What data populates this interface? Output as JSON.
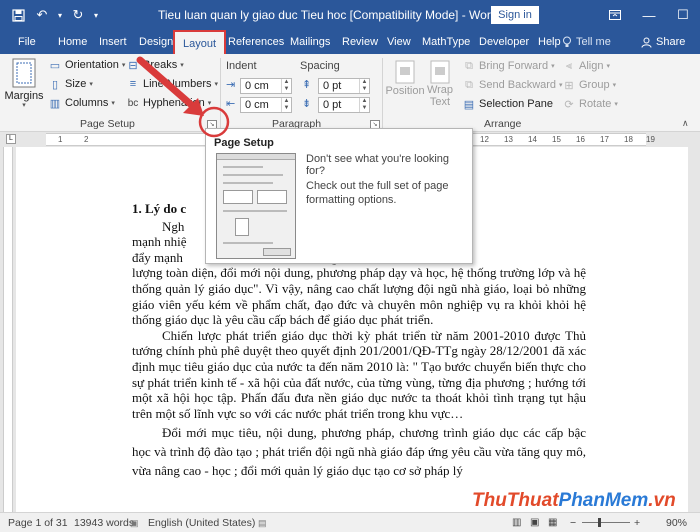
{
  "window": {
    "title": "Tieu luan quan ly giao duc Tieu hoc [Compatibility Mode] - Word",
    "sign_in": "Sign in"
  },
  "tabs": [
    "File",
    "Home",
    "Insert",
    "Design",
    "Layout",
    "References",
    "Mailings",
    "Review",
    "View",
    "MathType",
    "Developer",
    "Help"
  ],
  "active_tab": "Layout",
  "tell_me": "Tell me",
  "share": "Share",
  "ribbon": {
    "page_setup": {
      "margins": "Margins",
      "orientation": "Orientation",
      "size": "Size",
      "columns": "Columns",
      "breaks": "Breaks",
      "line_numbers": "Line Numbers",
      "hyphenation": "Hyphenation",
      "label": "Page Setup"
    },
    "paragraph": {
      "indent_label": "Indent",
      "spacing_label": "Spacing",
      "indent_left": "0 cm",
      "indent_right": "0 cm",
      "spacing_before": "0 pt",
      "spacing_after": "0 pt",
      "label": "Paragraph"
    },
    "arrange": {
      "position": "Position",
      "wrap_text_1": "Wrap",
      "wrap_text_2": "Text",
      "bring_forward": "Bring Forward",
      "send_backward": "Send Backward",
      "selection_pane": "Selection Pane",
      "align": "Align",
      "group": "Group",
      "rotate": "Rotate",
      "label": "Arrange"
    }
  },
  "tooltip": {
    "title": "Page Setup",
    "line1": "Don't see what you're looking for?",
    "line2": "Check out the full set of page formatting options."
  },
  "ruler_numbers": [
    "1",
    "2",
    "1",
    "2",
    "3",
    "4",
    "5",
    "6",
    "7",
    "8",
    "9",
    "10",
    "11",
    "12",
    "13",
    "14",
    "15",
    "16",
    "17",
    "18",
    "19"
  ],
  "document": {
    "heading": "1. Lý do c",
    "p1_lines": [
      "Ngh                                            X của Đảng đã nhấn",
      "mạnh nhiệ                                      rờng hotrong thời kỳ",
      "đẩy mạnh                                       cao giáo dục chất"
    ],
    "p1_rest": "lượng toàn diện, đổi mới nội dung, phương pháp dạy và học, hệ thống trường lớp và hệ thống quản lý giáo dục\". Vì vậy, nâng cao chất lượng đội ngũ nhà giáo, loại bỏ những giáo viên yếu kém về phẩm chất, đạo đức và chuyên môn nghiệp vụ ra khỏi khỏi hệ thống giáo dục là yêu cầu cấp bách để giáo dục phát triển.",
    "p2": "Chiến lược phát triển giáo dục thời kỳ phát triển từ năm 2001-2010 được Thủ tướng chính phủ phê duyệt theo quyết định 201/2001/QĐ-TTg ngày 28/12/2001 đã xác định mục tiêu giáo dục của nước ta đến năm 2010 là: \" Tạo bước chuyển biến thực cho sự phát triển kinh tế - xã hội của đất nước, của từng vùng, từng địa phương ; hướng tới một xã hội học tập. Phấn đấu đưa nền giáo dục nước ta thoát khỏi tình trạng tụt hậu trên một số lĩnh vực so với các nước phát triển trong khu vực…",
    "p3": "Đổi mới mục tiêu, nội dung, phương pháp, chương trình giáo dục các cấp bậc học và trình độ đào tạo ; phát triển đội ngũ nhà giáo đáp ứng yêu cầu vừa tăng quy mô, vừa nâng cao - học ; đổi mới quản lý giáo dục tạo cơ sở pháp lý"
  },
  "status": {
    "page": "Page 1 of 31",
    "words": "13943 words",
    "language": "English (United States)",
    "zoom": "90%"
  },
  "watermark": {
    "part1": "ThuThuat",
    "part2": "PhanMem",
    "part3": ".vn"
  },
  "colors": {
    "title_bar": "#2b579a",
    "annotation_red": "#d93b3b"
  }
}
